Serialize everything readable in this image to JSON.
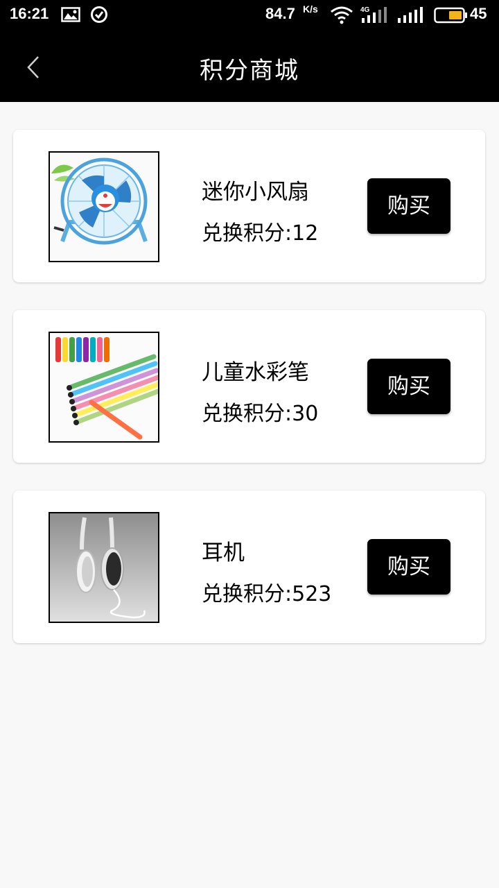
{
  "status_bar": {
    "time": "16:21",
    "speed": "84.7",
    "speed_unit": "K/s",
    "network": "4G",
    "battery": "45",
    "icons": [
      "image-icon",
      "check-circle-icon",
      "wifi-icon",
      "4g-signal-icon",
      "signal-icon",
      "battery-icon"
    ]
  },
  "header": {
    "title": "积分商城",
    "back_icon": "chevron-left-icon"
  },
  "products": [
    {
      "name": "迷你小风扇",
      "points": "兑换积分:12",
      "buy_label": "购买",
      "image": "mini-fan"
    },
    {
      "name": "儿童水彩笔",
      "points": "兑换积分:30",
      "buy_label": "购买",
      "image": "watercolor-pens"
    },
    {
      "name": "耳机",
      "points": "兑换积分:523",
      "buy_label": "购买",
      "image": "headphones"
    }
  ],
  "colors": {
    "header_bg": "#000000",
    "page_bg": "#f8f8f8",
    "card_bg": "#ffffff",
    "button_bg": "#000000",
    "button_text": "#ffffff",
    "battery_fill": "#f5b21b"
  }
}
